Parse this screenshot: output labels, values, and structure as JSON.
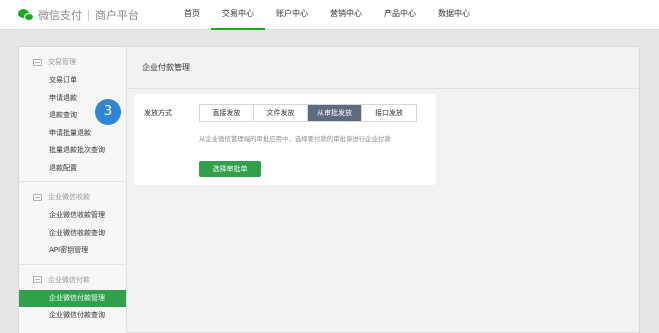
{
  "brand": {
    "name": "微信支付",
    "sub": "商户平台"
  },
  "nav": [
    {
      "label": "首页",
      "active": false
    },
    {
      "label": "交易中心",
      "active": true
    },
    {
      "label": "账户中心",
      "active": false
    },
    {
      "label": "营销中心",
      "active": false
    },
    {
      "label": "产品中心",
      "active": false
    },
    {
      "label": "数据中心",
      "active": false
    }
  ],
  "sidebar": {
    "groups": [
      {
        "title": "交易管理",
        "items": [
          "交易订单",
          "申请退款",
          "退款查询",
          "申请批量退款",
          "批量退款批次查询",
          "退款配置"
        ]
      },
      {
        "title": "企业微信收款",
        "items": [
          "企业微信收款管理",
          "企业微信收款查询",
          "API密钥管理"
        ]
      },
      {
        "title": "企业微信付款",
        "items": [
          "企业微信付款管理",
          "企业微信付款查询"
        ]
      }
    ],
    "active_item": "企业微信付款管理"
  },
  "main": {
    "title": "企业付款管理",
    "method_label": "发放方式",
    "tabs": [
      "直接发放",
      "文件发放",
      "从审批发放",
      "接口发放"
    ],
    "active_tab": "从审批发放",
    "description": "从企业微信管理端的审批应用中，选择要付款的审批单进行企业付款",
    "button_label": "选择审批单"
  },
  "step_badge": "3",
  "colors": {
    "accent": "#1aad19",
    "active_tab": "#5c6b80",
    "badge": "#2e86d9"
  }
}
